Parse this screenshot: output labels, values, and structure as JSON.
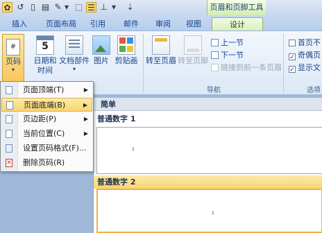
{
  "contextual_tab_group": "页眉和页脚工具",
  "tabs": [
    {
      "label": "插入"
    },
    {
      "label": "页面布局"
    },
    {
      "label": "引用"
    },
    {
      "label": "邮件"
    },
    {
      "label": "审阅"
    },
    {
      "label": "视图"
    },
    {
      "label": "设计"
    }
  ],
  "ribbon": {
    "page_number_label": "页码",
    "date_time_label_line1": "日期和",
    "date_time_label_line2": "时间",
    "doc_parts_label": "文档部件",
    "picture_label": "图片",
    "clipart_label": "剪贴画",
    "goto_header_label": "转至页眉",
    "goto_footer_label": "转至页脚",
    "prev_section_label": "上一节",
    "next_section_label": "下一节",
    "link_previous_label": "链接到前一条页眉",
    "navigation_group_label": "导航",
    "options_group_label": "选项",
    "option_first_page": "首页不",
    "option_odd_even": "奇偶页",
    "option_show_text": "显示文",
    "calendar_icon_text": "5"
  },
  "menu": {
    "items": [
      {
        "label": "页面顶端(T)",
        "submenu": true
      },
      {
        "label": "页面底端(B)",
        "submenu": true
      },
      {
        "label": "页边距(P)",
        "submenu": true
      },
      {
        "label": "当前位置(C)",
        "submenu": true
      },
      {
        "label": "设置页码格式(F)...",
        "submenu": false
      },
      {
        "label": "删除页码(R)",
        "submenu": false
      }
    ]
  },
  "gallery": {
    "section_title": "简单",
    "items": [
      {
        "title": "普通数字 1",
        "sample_number": "1"
      },
      {
        "title": "普通数字 2",
        "sample_number": "1"
      }
    ]
  },
  "colors": {
    "highlight": "#f9d571",
    "contextual_tab": "#d8efbd",
    "ribbon_text": "#15428b"
  }
}
